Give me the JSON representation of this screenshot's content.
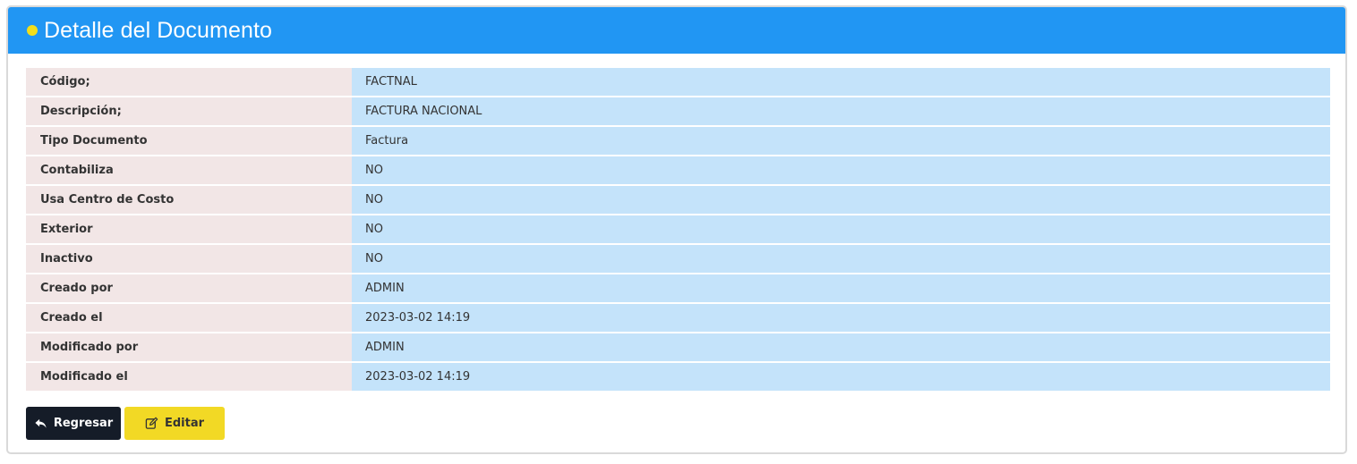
{
  "header": {
    "title": "Detalle del Documento"
  },
  "details": [
    {
      "label": "Código;",
      "value": "FACTNAL"
    },
    {
      "label": "Descripción;",
      "value": "FACTURA NACIONAL"
    },
    {
      "label": "Tipo Documento",
      "value": "Factura"
    },
    {
      "label": "Contabiliza",
      "value": "NO"
    },
    {
      "label": "Usa Centro de Costo",
      "value": "NO"
    },
    {
      "label": "Exterior",
      "value": "NO"
    },
    {
      "label": "Inactivo",
      "value": "NO"
    },
    {
      "label": "Creado por",
      "value": "ADMIN"
    },
    {
      "label": "Creado el",
      "value": "2023-03-02 14:19"
    },
    {
      "label": "Modificado por",
      "value": "ADMIN"
    },
    {
      "label": "Modificado el",
      "value": "2023-03-02 14:19"
    }
  ],
  "actions": {
    "back_label": "Regresar",
    "back_icon": "reply-arrow-icon",
    "edit_label": "Editar",
    "edit_icon": "edit-icon"
  },
  "colors": {
    "header_bg": "#2196f3",
    "dot": "#f2de1b",
    "label_bg": "#f2e6e6",
    "value_bg": "#c4e3fa",
    "back_button": "#151c28",
    "edit_button": "#f2d925"
  }
}
